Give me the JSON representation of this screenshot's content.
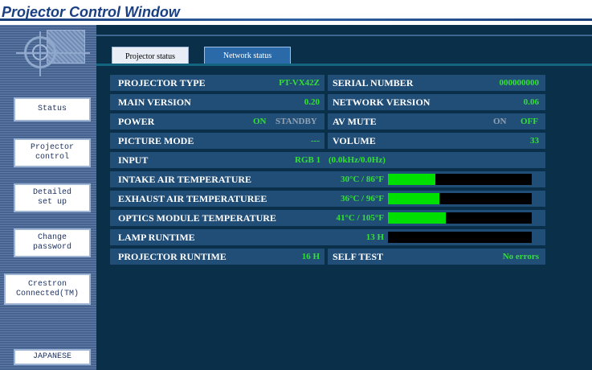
{
  "window": {
    "title": "Projector Control Window"
  },
  "sidebar": {
    "buttons": {
      "status": "Status",
      "projector_control": "Projector\ncontrol",
      "detailed_setup": "Detailed\nset up",
      "change_password": "Change\npassword",
      "crestron": "Crestron\nConnected(TM)",
      "language": "JAPANESE"
    }
  },
  "tabs": {
    "projector_status": "Projector status",
    "network_status": "Network status"
  },
  "status": {
    "projector_type": {
      "label": "PROJECTOR TYPE",
      "value": "PT-VX42Z"
    },
    "serial_number": {
      "label": "SERIAL NUMBER",
      "value": "000000000"
    },
    "main_version": {
      "label": "MAIN VERSION",
      "value": "0.20"
    },
    "network_version": {
      "label": "NETWORK VERSION",
      "value": "0.06"
    },
    "power": {
      "label": "POWER",
      "on": "ON",
      "standby": "STANDBY",
      "active": "ON"
    },
    "av_mute": {
      "label": "AV MUTE",
      "on": "ON",
      "off": "OFF",
      "active": "OFF"
    },
    "picture_mode": {
      "label": "PICTURE MODE",
      "value": "---"
    },
    "volume": {
      "label": "VOLUME",
      "value": "33"
    },
    "input": {
      "label": "INPUT",
      "value": "RGB 1",
      "signal": "(0.0kHz/0.0Hz)"
    },
    "intake_air_temp": {
      "label": "INTAKE AIR TEMPERATURE",
      "value": "30°C / 86°F",
      "level": 0.33
    },
    "exhaust_air_temp": {
      "label": "EXHAUST AIR TEMPERATUREE",
      "value": "36°C / 96°F",
      "level": 0.36
    },
    "optics_module_temp": {
      "label": "OPTICS MODULE TEMPERATURE",
      "value": "41°C / 105°F",
      "level": 0.4
    },
    "lamp_runtime": {
      "label": "LAMP RUNTIME",
      "value": "13 H",
      "level": 0.0
    },
    "projector_runtime": {
      "label": "PROJECTOR RUNTIME",
      "value": "16 H"
    },
    "self_test": {
      "label": "SELF TEST",
      "value": "No errors"
    }
  },
  "colors": {
    "accent_value": "#33e033",
    "bar_fill": "#00e000",
    "row_bg": "#214e77",
    "panel_bg": "#0a2f49"
  }
}
